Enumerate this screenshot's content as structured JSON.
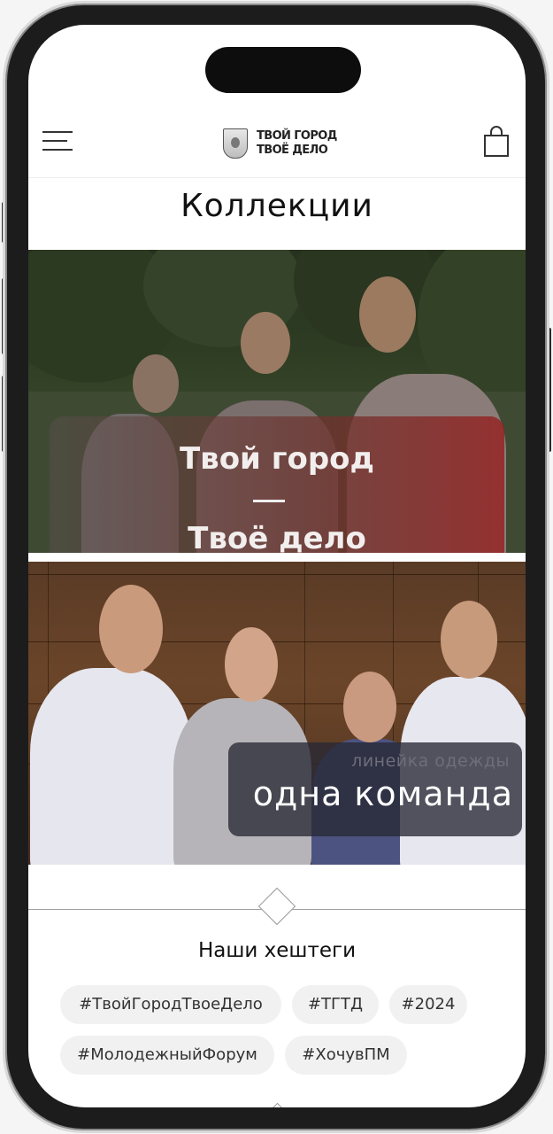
{
  "header": {
    "logo_line1": "ТВОЙ ГОРОД",
    "logo_line2": "ТВОЁ ДЕЛО"
  },
  "page": {
    "title": "Коллекции"
  },
  "collections": [
    {
      "title_top": "Твой город",
      "title_bottom": "Твоё дело",
      "accent": "#9e1e1e"
    },
    {
      "subtitle": "линейка одежды",
      "title": "одна команда"
    }
  ],
  "hashtags": {
    "title": "Наши хештеги",
    "items": [
      "#ТвойГородТвоеДело",
      "#ТГТД",
      "#2024",
      "#МолодежныйФорум",
      "#ХочувПМ"
    ]
  },
  "colors": {
    "background": "#ffffff",
    "tag_bg": "#f1f1f1",
    "text": "#111111"
  }
}
